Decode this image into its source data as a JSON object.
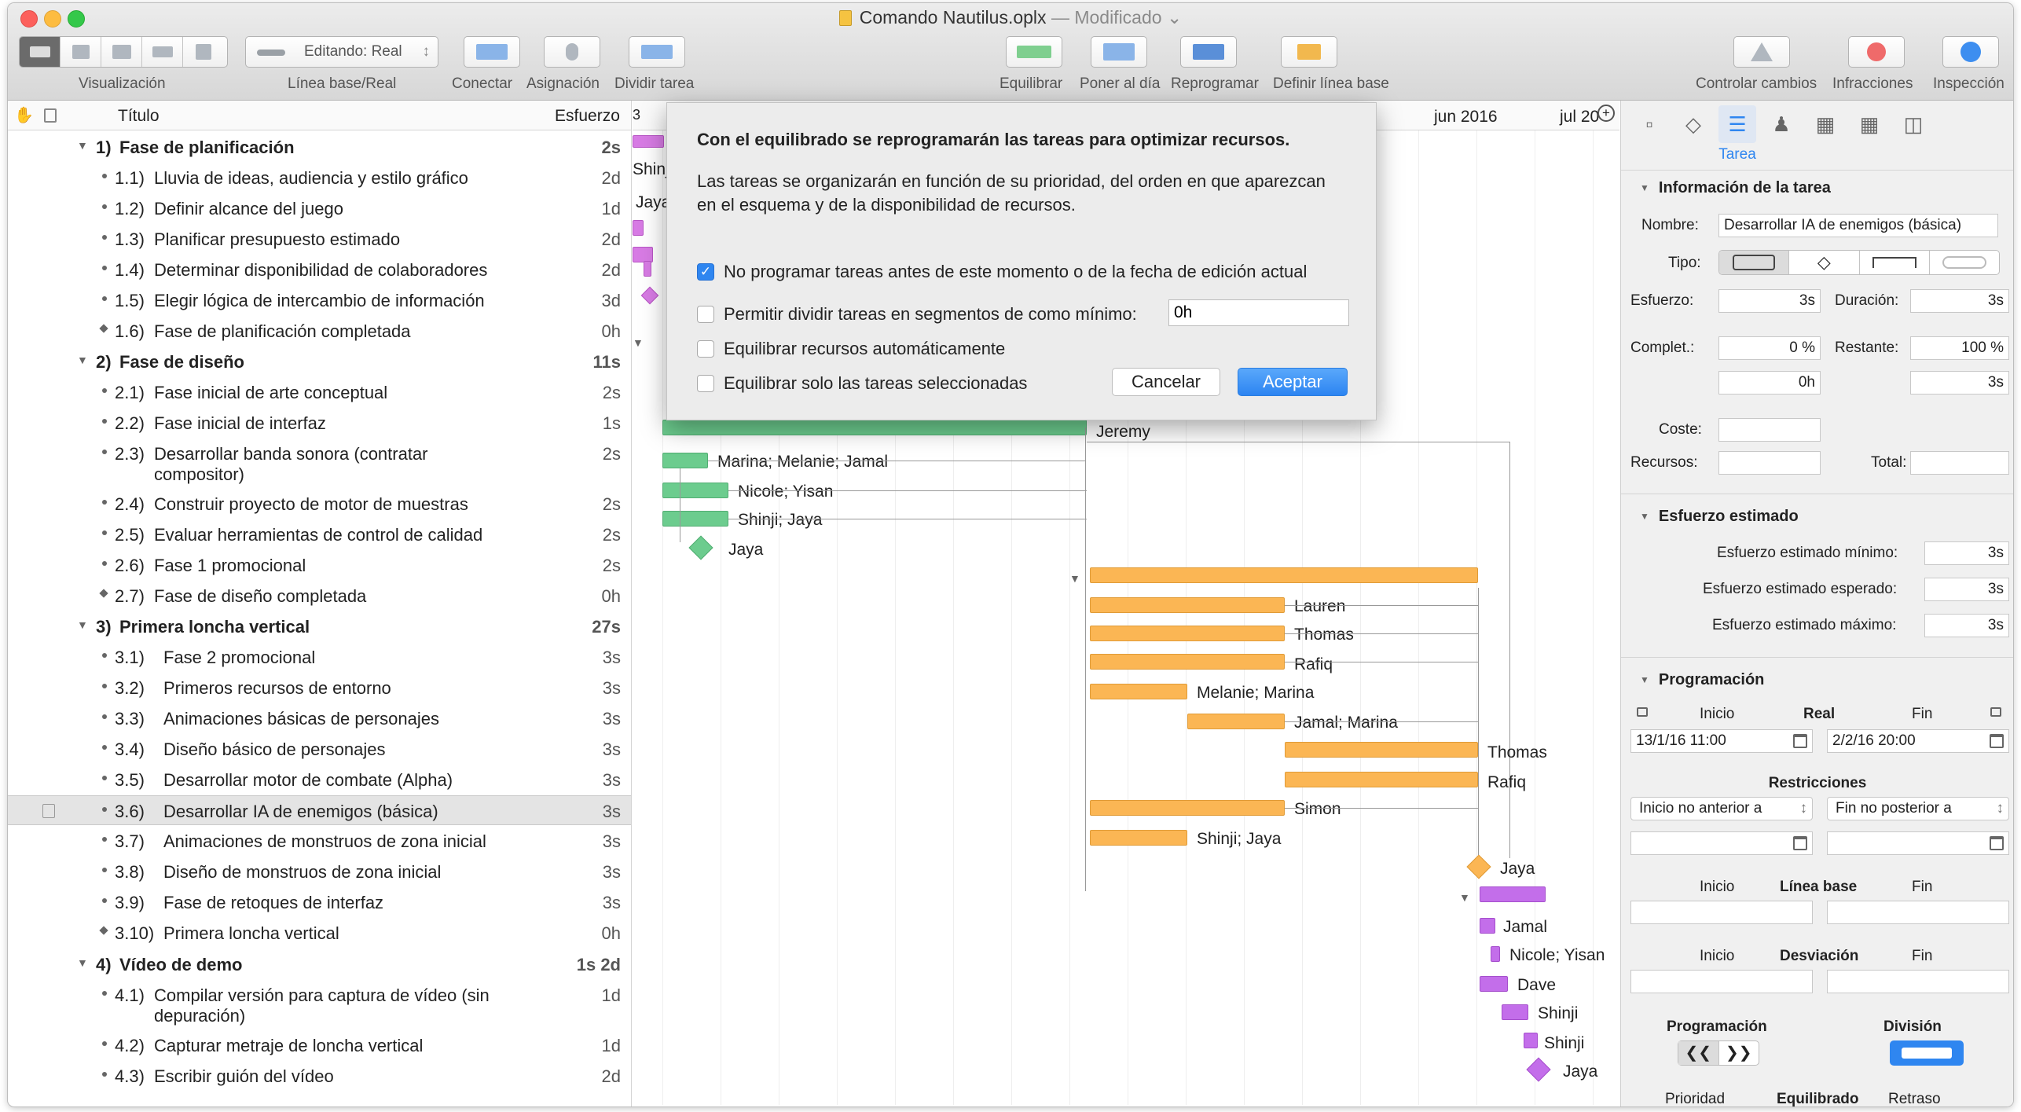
{
  "window": {
    "title": "Comando Nautilus.oplx",
    "status": "— Modificado"
  },
  "toolbar": {
    "visualizacion_label": "Visualización",
    "baseline_value": "Editando: Real",
    "baseline_label": "Línea base/Real",
    "conectar": "Conectar",
    "asignacion": "Asignación",
    "dividir": "Dividir tarea",
    "equilibrar": "Equilibrar",
    "poner": "Poner al día",
    "reprogramar": "Reprogramar",
    "definir": "Definir línea base",
    "controlar": "Controlar cambios",
    "infracciones": "Infracciones",
    "inspeccion": "Inspección"
  },
  "outline": {
    "col_title": "Título",
    "col_effort": "Esfuerzo",
    "rows": [
      {
        "num": "1)",
        "title": "Fase de planificación",
        "effort": "2s",
        "kind": "group"
      },
      {
        "num": "1.1)",
        "title": "Lluvia de ideas, audiencia y estilo gráfico",
        "effort": "2d",
        "kind": "task"
      },
      {
        "num": "1.2)",
        "title": "Definir alcance del juego",
        "effort": "1d",
        "kind": "task"
      },
      {
        "num": "1.3)",
        "title": "Planificar presupuesto estimado",
        "effort": "2d",
        "kind": "task"
      },
      {
        "num": "1.4)",
        "title": "Determinar disponibilidad de colaboradores",
        "effort": "2d",
        "kind": "task"
      },
      {
        "num": "1.5)",
        "title": "Elegir lógica de intercambio de información",
        "effort": "3d",
        "kind": "task"
      },
      {
        "num": "1.6)",
        "title": "Fase de planificación completada",
        "effort": "0h",
        "kind": "milestone"
      },
      {
        "num": "2)",
        "title": "Fase de diseño",
        "effort": "11s",
        "kind": "group"
      },
      {
        "num": "2.1)",
        "title": "Fase inicial de arte conceptual",
        "effort": "2s",
        "kind": "task"
      },
      {
        "num": "2.2)",
        "title": "Fase inicial de interfaz",
        "effort": "1s",
        "kind": "task"
      },
      {
        "num": "2.3)",
        "title": "Desarrollar banda sonora (contratar",
        "title2": "compositor)",
        "effort": "2s",
        "kind": "task"
      },
      {
        "num": "2.4)",
        "title": "Construir proyecto de motor de muestras",
        "effort": "2s",
        "kind": "task"
      },
      {
        "num": "2.5)",
        "title": "Evaluar herramientas de control de calidad",
        "effort": "2s",
        "kind": "task"
      },
      {
        "num": "2.6)",
        "title": "Fase 1 promocional",
        "effort": "2s",
        "kind": "task"
      },
      {
        "num": "2.7)",
        "title": "Fase de diseño completada",
        "effort": "0h",
        "kind": "milestone"
      },
      {
        "num": "3)",
        "title": "Primera loncha vertical",
        "effort": "27s",
        "kind": "group"
      },
      {
        "num": "3.1)",
        "title": "Fase 2 promocional",
        "effort": "3s",
        "kind": "task"
      },
      {
        "num": "3.2)",
        "title": "Primeros recursos de entorno",
        "effort": "3s",
        "kind": "task"
      },
      {
        "num": "3.3)",
        "title": "Animaciones básicas de personajes",
        "effort": "3s",
        "kind": "task"
      },
      {
        "num": "3.4)",
        "title": "Diseño básico de personajes",
        "effort": "3s",
        "kind": "task"
      },
      {
        "num": "3.5)",
        "title": "Desarrollar motor de combate (Alpha)",
        "effort": "3s",
        "kind": "task"
      },
      {
        "num": "3.6)",
        "title": "Desarrollar IA de enemigos (básica)",
        "effort": "3s",
        "kind": "task",
        "selected": true
      },
      {
        "num": "3.7)",
        "title": "Animaciones de monstruos de zona inicial",
        "effort": "3s",
        "kind": "task"
      },
      {
        "num": "3.8)",
        "title": "Diseño de monstruos de zona inicial",
        "effort": "3s",
        "kind": "task"
      },
      {
        "num": "3.9)",
        "title": "Fase de retoques de interfaz",
        "effort": "3s",
        "kind": "task"
      },
      {
        "num": "3.10)",
        "title": "Primera loncha vertical",
        "effort": "0h",
        "kind": "milestone"
      },
      {
        "num": "4)",
        "title": "Vídeo de demo",
        "effort": "1s 2d",
        "kind": "group"
      },
      {
        "num": "4.1)",
        "title": "Compilar versión para captura de vídeo (sin",
        "title2": "depuración)",
        "effort": "1d",
        "kind": "task"
      },
      {
        "num": "4.2)",
        "title": "Capturar metraje de loncha vertical",
        "effort": "1d",
        "kind": "task"
      },
      {
        "num": "4.3)",
        "title": "Escribir guión del vídeo",
        "effort": "2d",
        "kind": "task"
      }
    ]
  },
  "gantt": {
    "months": [
      "jun 2016",
      "jul 20"
    ],
    "labels": {
      "shinji_a": "Shinji",
      "jaya_a": "Jaya",
      "jeremy": "Jeremy",
      "mmj": "Marina; Melanie; Jamal",
      "ny": "Nicole; Yisan",
      "sj": "Shinji; Jaya",
      "jaya_b": "Jaya",
      "lauren": "Lauren",
      "thomas": "Thomas",
      "rafiq": "Rafiq",
      "melmar": "Melanie; Marina",
      "jamar": "Jamal; Marina",
      "thomas2": "Thomas",
      "rafiq2": "Rafiq",
      "simon": "Simon",
      "sj2": "Shinji; Jaya",
      "jaya_c": "Jaya",
      "jamal": "Jamal",
      "ny2": "Nicole; Yisan",
      "dave": "Dave",
      "shinji_b": "Shinji",
      "shinji_c": "Shinji",
      "jaya_d": "Jaya"
    }
  },
  "dialog": {
    "title": "Con el equilibrado se reprogramarán las tareas para optimizar recursos.",
    "desc": "Las tareas se organizarán en función de su prioridad, del orden en que aparezcan en el esquema y de la disponibilidad de recursos.",
    "opt1": "No programar tareas antes de este momento o de la fecha de edición actual",
    "opt2": "Permitir dividir tareas en segmentos de como mínimo:",
    "opt2_value": "0h",
    "opt3": "Equilibrar recursos automáticamente",
    "opt4": "Equilibrar solo las tareas seleccionadas",
    "cancel": "Cancelar",
    "ok": "Aceptar"
  },
  "inspector": {
    "tab_label": "Tarea",
    "info_header": "Información de la tarea",
    "name_label": "Nombre:",
    "name_value": "Desarrollar IA de enemigos (básica)",
    "type_label": "Tipo:",
    "effort_label": "Esfuerzo:",
    "effort_value": "3s",
    "duration_label": "Duración:",
    "duration_value": "3s",
    "complete_label": "Complet.:",
    "complete_value": "0 %",
    "remaining_label": "Restante:",
    "remaining_value": "100 %",
    "complete_h": "0h",
    "remaining_s": "3s",
    "cost_label": "Coste:",
    "resources_label": "Recursos:",
    "total_label": "Total:",
    "est_header": "Esfuerzo estimado",
    "est_min_label": "Esfuerzo estimado mínimo:",
    "est_min": "3s",
    "est_exp_label": "Esfuerzo estimado esperado:",
    "est_exp": "3s",
    "est_max_label": "Esfuerzo estimado máximo:",
    "est_max": "3s",
    "sched_header": "Programación",
    "start": "Inicio",
    "real": "Real",
    "end": "Fin",
    "start_value": "13/1/16 11:00",
    "end_value": "2/2/16 20:00",
    "restr_header": "Restricciones",
    "restr_start": "Inicio no anterior a",
    "restr_end": "Fin no posterior a",
    "baseline": "Línea base",
    "deviation": "Desviación",
    "prog_label": "Programación",
    "div_label": "División",
    "priority": "Prioridad",
    "leveled": "Equilibrado",
    "delay": "Retraso"
  }
}
